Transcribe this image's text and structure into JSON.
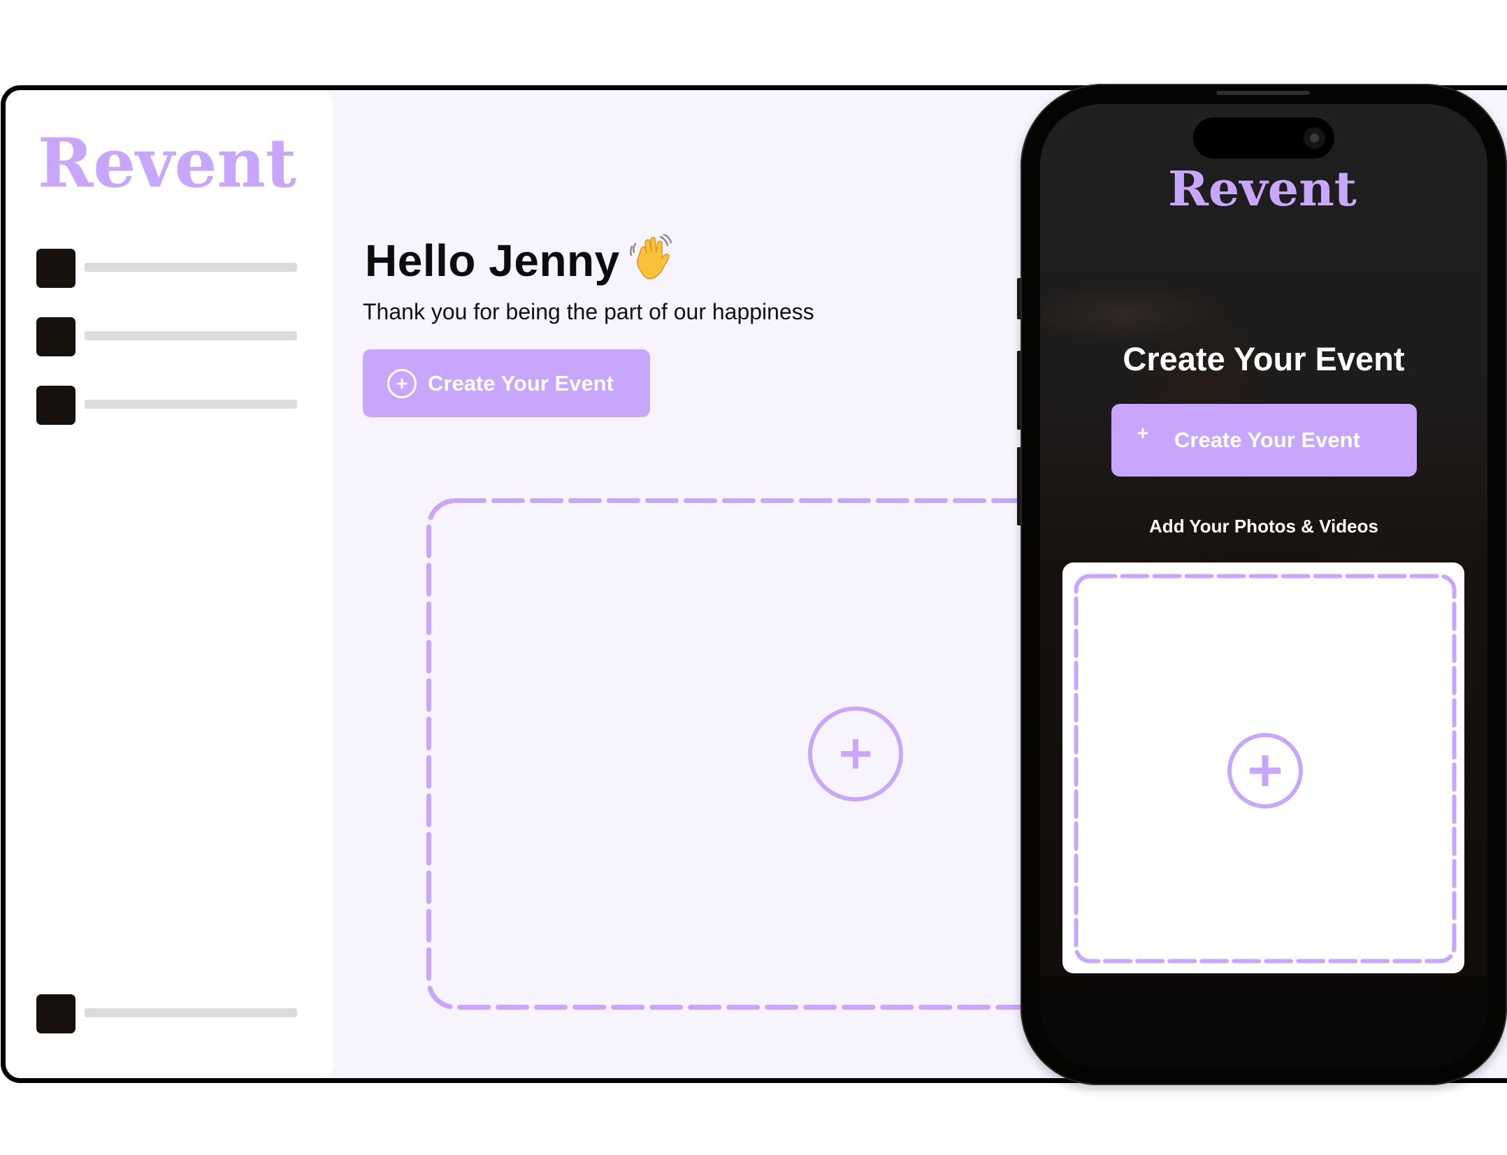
{
  "brand": {
    "name": "Revent",
    "accent_color": "#c8a6fb",
    "background_color": "#f7f4fe"
  },
  "sidebar": {
    "logo_text": "Revent",
    "items": [
      {
        "icon": "placeholder-square-icon",
        "label": ""
      },
      {
        "icon": "placeholder-square-icon",
        "label": ""
      },
      {
        "icon": "placeholder-square-icon",
        "label": ""
      }
    ],
    "footer_item": {
      "icon": "placeholder-square-icon",
      "label": ""
    }
  },
  "main": {
    "greeting": "Hello Jenny",
    "greeting_emoji": "👋",
    "subtitle": "Thank you for being the part of our happiness",
    "create_button": {
      "label": "Create Your Event",
      "icon": "plus-circle-icon"
    },
    "upload_area": {
      "icon": "plus-circle-icon"
    }
  },
  "phone": {
    "logo_text": "Revent",
    "title": "Create Your Event",
    "create_button": {
      "label": "Create Your Event",
      "icon": "plus-circle-icon"
    },
    "upload_label": "Add Your Photos & Videos",
    "upload_area": {
      "icon": "plus-circle-icon"
    }
  }
}
